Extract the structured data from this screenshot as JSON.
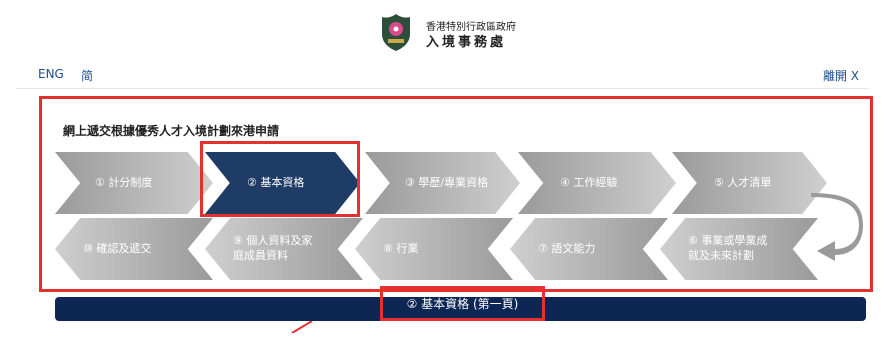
{
  "header": {
    "dept_zh": "香港特別行政區政府",
    "dept_name": "入境事務處",
    "emblem_icon": "immigration-emblem-icon"
  },
  "topnav": {
    "eng": "ENG",
    "simplified": "简",
    "exit": "離開 X"
  },
  "form_title": "網上遞交根據優秀人才入境計劃來港申請",
  "steps_row1": [
    {
      "label": "① 計分制度",
      "state": "inactive"
    },
    {
      "label": "② 基本資格",
      "state": "active"
    },
    {
      "label": "③ 學歷/專業資格",
      "state": "inactive"
    },
    {
      "label": "④ 工作經驗",
      "state": "inactive"
    },
    {
      "label": "⑤ 人才清單",
      "state": "inactive"
    }
  ],
  "steps_row2": [
    {
      "label": "⑩ 確認及遞交",
      "state": "inactive"
    },
    {
      "label": "⑨ 個人資料及家庭成員資料",
      "state": "inactive"
    },
    {
      "label": "⑧ 行業",
      "state": "inactive"
    },
    {
      "label": "⑦ 語文能力",
      "state": "inactive"
    },
    {
      "label": "⑥ 事業或學業成就及未來計劃",
      "state": "inactive"
    }
  ],
  "page_header": "② 基本資格 (第一頁)",
  "colors": {
    "active": "#1f3c66",
    "highlight": "#e53030",
    "bar": "#0d2654",
    "link": "#1f4e8c"
  }
}
